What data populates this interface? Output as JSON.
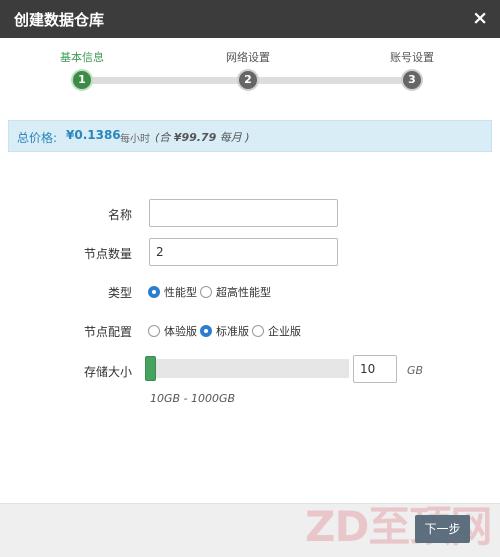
{
  "dialog": {
    "title": "创建数据仓库",
    "close_icon": "×"
  },
  "steps": [
    {
      "label": "基本信息",
      "number": "1",
      "active": true
    },
    {
      "label": "网络设置",
      "number": "2",
      "active": false
    },
    {
      "label": "账号设置",
      "number": "3",
      "active": false
    }
  ],
  "price": {
    "label": "总价格:",
    "amount": "¥0.1386",
    "unit": "每小时",
    "monthly_prefix": "(合 ",
    "monthly_amount": "¥99.79",
    "monthly_suffix": " 每月 )"
  },
  "form": {
    "name": {
      "label": "名称",
      "value": ""
    },
    "node_count": {
      "label": "节点数量",
      "value": "2"
    },
    "type": {
      "label": "类型",
      "options": [
        {
          "label": "性能型",
          "checked": true
        },
        {
          "label": "超高性能型",
          "checked": false
        }
      ]
    },
    "node_config": {
      "label": "节点配置",
      "options": [
        {
          "label": "体验版",
          "checked": false
        },
        {
          "label": "标准版",
          "checked": true
        },
        {
          "label": "企业版",
          "checked": false
        }
      ]
    },
    "storage": {
      "label": "存储大小",
      "value": "10",
      "unit": "GB",
      "range_hint": "10GB - 1000GB",
      "slider_fraction": 0
    }
  },
  "footer": {
    "next_label": "下一步"
  },
  "watermark": "ZD至顶网",
  "colors": {
    "titlebar": "#3c3c3c",
    "active_step": "#3d8b46",
    "price_bg": "#d9edf7",
    "price_text": "#2a86b8",
    "radio_checked": "#2d7dd2",
    "slider_handle": "#46a35e",
    "next_button": "#5d6e7e"
  }
}
